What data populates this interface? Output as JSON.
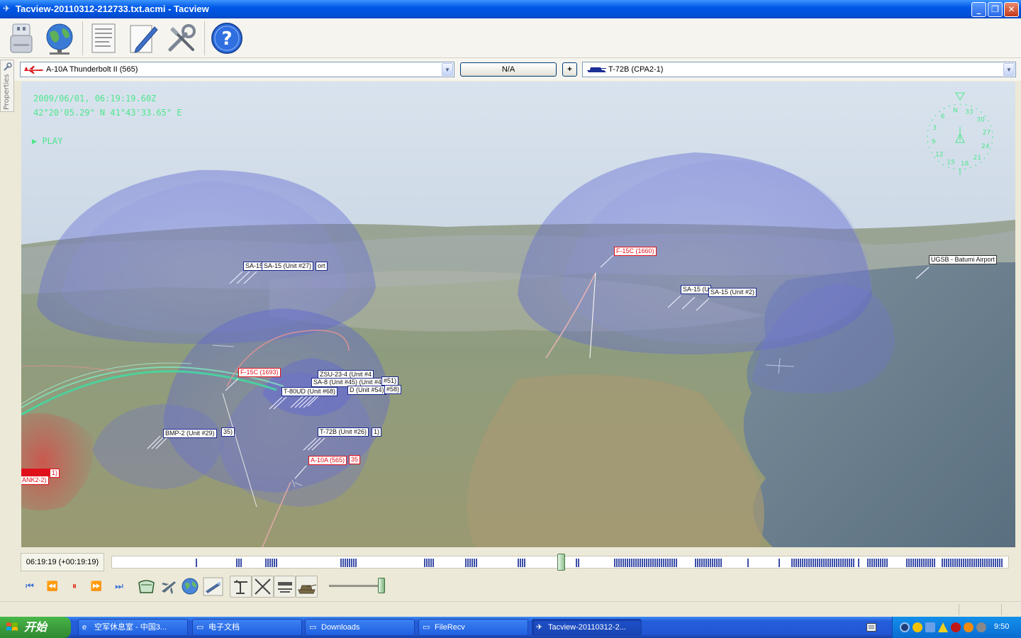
{
  "window": {
    "title": "Tacview-20110312-212733.txt.acmi - Tacview",
    "minimize": "_",
    "restore": "❐",
    "close": "✕"
  },
  "toolbar": {
    "icons": [
      "usb-drive-icon",
      "globe-network-icon",
      "document-icon",
      "edit-notes-icon",
      "tools-icon",
      "help-icon"
    ],
    "help_glyph": "?"
  },
  "selectors": {
    "primary_object": "A-10A Thunderbolt II (565)",
    "relation": "N/A",
    "add": "+",
    "secondary_object": "T-72B (CPA2-1)"
  },
  "side_panel": {
    "tab_label": "Properties"
  },
  "hud": {
    "datetime": "2009/06/01, 06:19:19.60Z",
    "coordinates": "42°20'05.29\" N  41°43'33.65\" E",
    "play_state": "PLAY",
    "compass_ticks": [
      "3",
      "6",
      "N",
      "33",
      "30",
      "27",
      "24",
      "21",
      "18",
      "15",
      "12",
      "9"
    ]
  },
  "labels": [
    {
      "id": "sa15-27-back",
      "text": "SA-15",
      "type": "blue"
    },
    {
      "id": "sa15-27",
      "text": "SA-15 (Unit #27)",
      "type": "blue"
    },
    {
      "id": "sa15-27-tail",
      "text": "ort",
      "type": "blue"
    },
    {
      "id": "f15c-1660",
      "text": "F-15C (1660)",
      "type": "red"
    },
    {
      "id": "ugsb",
      "text": "UGSB - Batumi Airport",
      "type": "black"
    },
    {
      "id": "sa15-2-back",
      "text": "SA-15 (U",
      "type": "blue"
    },
    {
      "id": "sa15-2",
      "text": "SA-15 (Unit #2)",
      "type": "blue"
    },
    {
      "id": "f15c-1693",
      "text": "F-15C (1693)",
      "type": "red"
    },
    {
      "id": "zsu",
      "text": "ZSU-23-4 (Unit #4",
      "type": "blue"
    },
    {
      "id": "sa8-49",
      "text": "SA-8 (Unit #45) (Unit #49)",
      "type": "blue"
    },
    {
      "id": "unit51",
      "text": "#51)",
      "type": "blue"
    },
    {
      "id": "t80ud-68",
      "text": "T-80UD (Unit #68)",
      "type": "blue"
    },
    {
      "id": "unit54",
      "text": "D (Unit #54)",
      "type": "blue"
    },
    {
      "id": "unit58",
      "text": "#58)",
      "type": "blue"
    },
    {
      "id": "bmp2-29",
      "text": "BMP-2 (Unit #29)",
      "type": "blue"
    },
    {
      "id": "unit35",
      "text": "35)",
      "type": "blue"
    },
    {
      "id": "t72b-26",
      "text": "T-72B (Unit #26)",
      "type": "blue"
    },
    {
      "id": "unit-1",
      "text": "1)",
      "type": "blue"
    },
    {
      "id": "a10a-565",
      "text": "A-10A (565)",
      "type": "red"
    },
    {
      "id": "a10a-tail",
      "text": "35",
      "type": "red"
    },
    {
      "id": "ank2",
      "text": "ANK2-2)",
      "type": "red"
    },
    {
      "id": "ank2-tail",
      "text": "1)",
      "type": "red"
    }
  ],
  "playback": {
    "time_label": "06:19:19 (+00:19:19)",
    "position_fraction": 0.5,
    "speed_fraction": 0.9,
    "buttons": [
      "skip-to-start",
      "step-back",
      "pause",
      "step-forward",
      "skip-to-end"
    ],
    "glyphs": {
      "start": "⏮",
      "back": "⏪",
      "pause": "⏸",
      "forward": "⏩",
      "end": "⏭"
    },
    "view_buttons": [
      "cockpit-view-icon",
      "aircraft-view-icon",
      "world-view-icon",
      "satellite-view-icon",
      "sam-filter-icon",
      "crossed-weapons-icon",
      "radar-icon",
      "tank-icon"
    ]
  },
  "taskbar": {
    "start_label": "开始",
    "tasks": [
      {
        "label": "空军休息室 - 中国3...",
        "icon": "e"
      },
      {
        "label": "电子文档",
        "icon": "▭"
      },
      {
        "label": "Downloads",
        "icon": "▭"
      },
      {
        "label": "FileRecv",
        "icon": "▭"
      },
      {
        "label": "Tacview-20110312-2...",
        "icon": "✈"
      }
    ],
    "clock": "9:50"
  },
  "colors": {
    "hud_green": "#4ee68c",
    "blue_label_border": "#1c2a8c",
    "red_label": "#e0101a",
    "title_bar": "#0058e6",
    "taskbar": "#245edb"
  }
}
